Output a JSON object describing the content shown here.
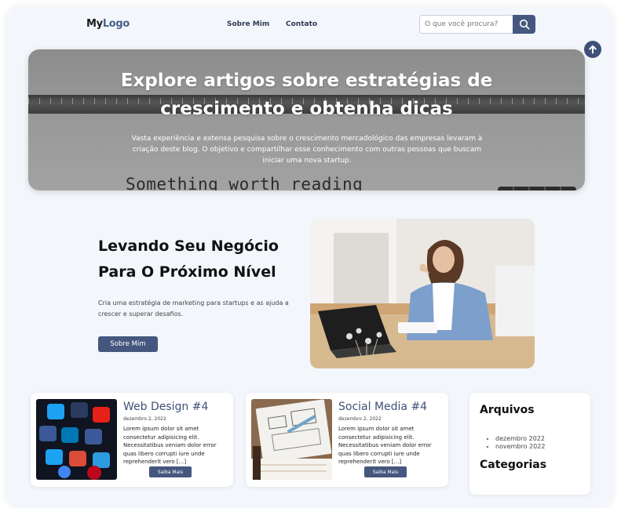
{
  "header": {
    "logo_main": "My",
    "logo_accent": "Logo",
    "nav": [
      {
        "label": "Sobre Mim"
      },
      {
        "label": "Contato"
      }
    ],
    "search": {
      "placeholder": "O que você procura?",
      "value": ""
    }
  },
  "hero": {
    "title_line1": "Explore artigos sobre estratégias de",
    "title_line2": "crescimento e obtenha dicas",
    "subtitle": "Vasta experiência e extensa pesquisa sobre o crescimento mercadológico das empresas levaram à criação deste blog. O objetivo e compartilhar esse conhecimento com outras pessoas que buscam iniciar uma nova startup.",
    "image_text": "Something worth reading"
  },
  "feature": {
    "title_line1": "Levando Seu Negócio",
    "title_line2": "Para O Próximo Nível",
    "text": "Cria uma estratégia de marketing para startups e as ajuda a crescer e superar desafios.",
    "button": "Sobre Mim"
  },
  "posts": [
    {
      "title": "Web Design #4",
      "date": "dezembro 2, 2022",
      "excerpt": "Lorem ipsum dolor sit amet consectetur adipisicing elit. Necessitatibus veniam dolor error quas libero corrupti iure unde reprehenderit vero [...]",
      "button": "Saiba Mais"
    },
    {
      "title": "Social Media #4",
      "date": "dezembro 2, 2022",
      "excerpt": "Lorem ipsum dolor sit amet consectetur adipisicing elit. Necessitatibus veniam dolor error quas libero corrupti iure unde reprehenderit vero [...]",
      "button": "Saiba Mais"
    }
  ],
  "sidebar": {
    "archives_heading": "Arquivos",
    "archives": [
      "dezembro 2022",
      "novembro 2022"
    ],
    "categories_heading": "Categorias"
  }
}
